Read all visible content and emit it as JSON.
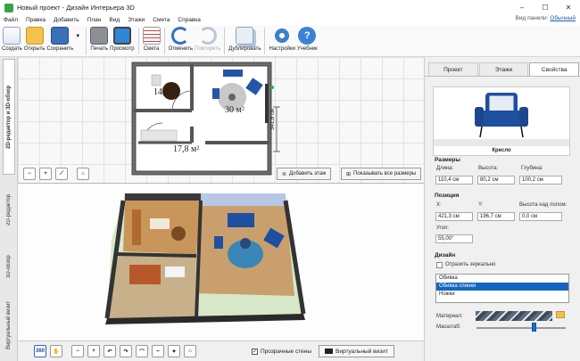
{
  "window": {
    "title": "Новый проект - Дизайн Интерьера 3D",
    "controls": [
      "–",
      "☐",
      "✕"
    ]
  },
  "menu": {
    "items": [
      "Файл",
      "Правка",
      "Добавить",
      "План",
      "Вид",
      "Этажи",
      "Смета",
      "Справка"
    ],
    "panel_label": "Вид панели:",
    "panel_value": "Обычный"
  },
  "toolbar": {
    "buttons": [
      {
        "label": "Создать",
        "icon": "new-file-icon"
      },
      {
        "label": "Открыть",
        "icon": "folder-open-icon"
      },
      {
        "label": "Сохранить",
        "icon": "save-icon"
      },
      {
        "label": "Печать",
        "icon": "printer-icon"
      },
      {
        "label": "Просмотр",
        "icon": "monitor-icon"
      },
      {
        "label": "Смета",
        "icon": "estimate-icon"
      },
      {
        "label": "Отменить",
        "icon": "undo-icon"
      },
      {
        "label": "Повторить",
        "icon": "redo-icon"
      },
      {
        "label": "Дублировать",
        "icon": "duplicate-icon"
      },
      {
        "label": "Настройки",
        "icon": "gear-icon"
      },
      {
        "label": "Учебник",
        "icon": "help-icon"
      }
    ]
  },
  "left_tabs": [
    "2D-редактор и 3D-обзор",
    "2D-редактор",
    "3D-обзор",
    "Виртуальный визит"
  ],
  "plan": {
    "room1_area": "14,2 м²",
    "room2_area": "30 м²",
    "room3_area": "17,8 м²",
    "dimension": "341,8 см",
    "add_floor": "Добавить этаж",
    "show_dims": "Показывать все размеры"
  },
  "bottom": {
    "transparent_walls": "Прозрачные стены",
    "virtual_visit": "Виртуальный визит",
    "btn_360": "360"
  },
  "right_panel": {
    "tabs": [
      "Проект",
      "Этажи",
      "Свойства"
    ],
    "preview_caption": "Кресло",
    "size_section": "Размеры",
    "length_label": "Длина:",
    "length": "110,4 см",
    "height_label": "Высота:",
    "height": "80,2 см",
    "depth_label": "Глубина:",
    "depth": "100,2 см",
    "position_section": "Позиция",
    "x_label": "X:",
    "x": "421,3 см",
    "y_label": "Y:",
    "y": "196,7 см",
    "elev_label": "Высота над полом:",
    "elev": "0,0 см",
    "angle_label": "Угол:",
    "angle": "55,00°",
    "design_section": "Дизайн",
    "mirror_label": "Отразить зеркально",
    "materials": [
      "Обивка",
      "Обивка спинки",
      "Ножки"
    ],
    "selected_material_index": 1,
    "material_label": "Материал:",
    "scale_label": "Масштаб:"
  },
  "colors": {
    "accent": "#1565c0",
    "chair_blue": "#1f4fa0",
    "floor_wood": "#c79a63"
  }
}
